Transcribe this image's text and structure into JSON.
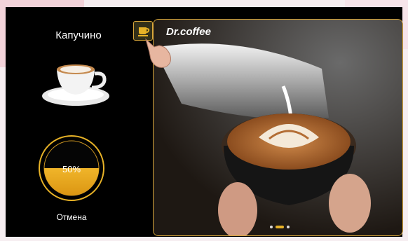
{
  "product": {
    "name": "Капучино"
  },
  "progress": {
    "percent": 50,
    "label": "50%"
  },
  "actions": {
    "cancel_label": "Отмена"
  },
  "banner": {
    "brand": "Dr.coffee"
  },
  "carousel": {
    "slides": 3,
    "active_index": 1
  },
  "colors": {
    "accent": "#e7b227",
    "background": "#000000",
    "text": "#ffffff"
  },
  "icons": {
    "cup_button": "coffee-cup-icon",
    "pointer": "pointing-hand-icon"
  }
}
